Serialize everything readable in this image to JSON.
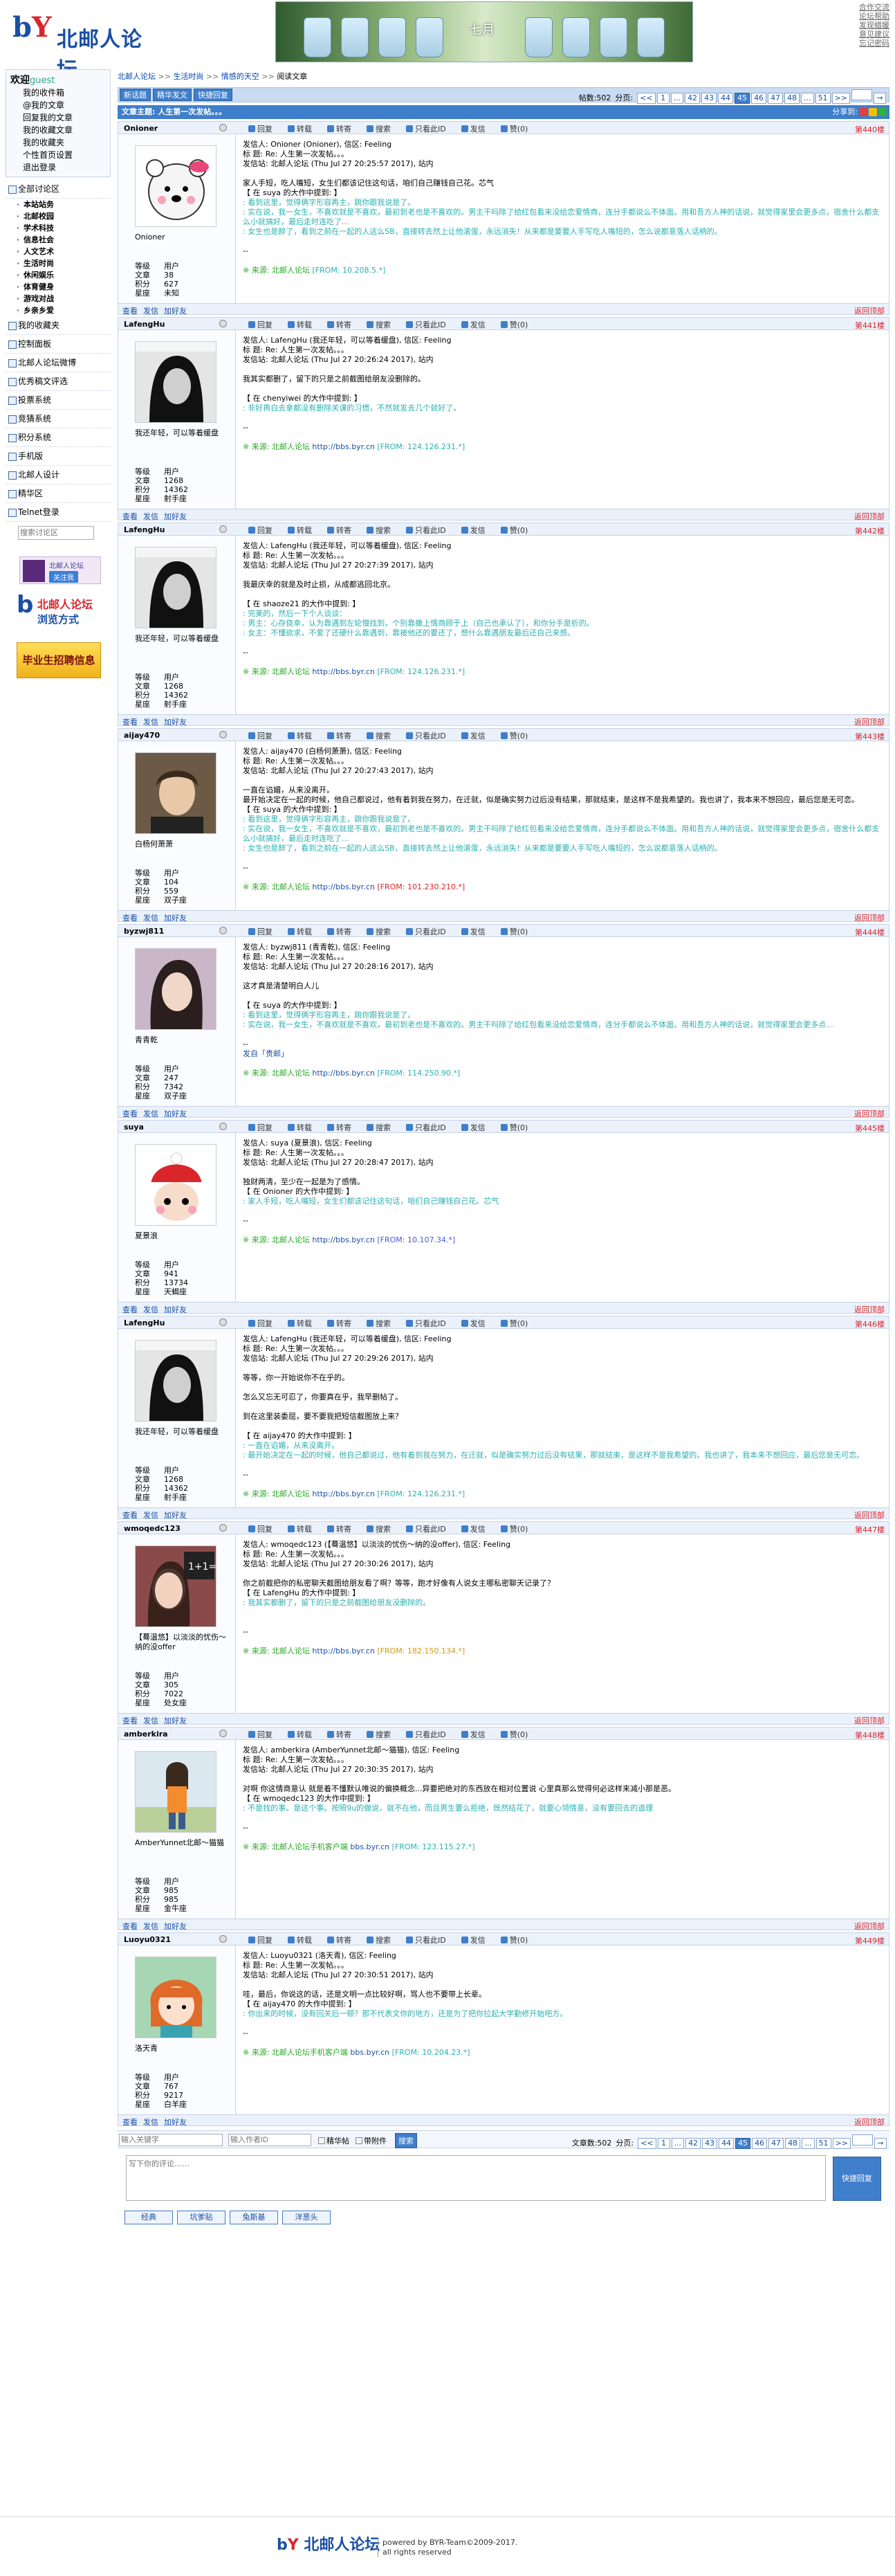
{
  "header": {
    "logo_text": "北邮人论坛",
    "banner_text": "七月",
    "top_links": [
      "合作交流",
      "论坛帮助",
      "发现蜡媛",
      "意见建议",
      "忘记密码"
    ]
  },
  "sidebar": {
    "welcome": "欢迎",
    "user": "guest",
    "links": [
      "我的收件箱",
      "@我的文章",
      "回复我的文章",
      "我的收藏文章",
      "我的收藏夹",
      "个性首页设置",
      "退出登录"
    ],
    "sections": [
      {
        "label": "全部讨论区",
        "subs": [
          "本站站务",
          "北邮校园",
          "学术科技",
          "信息社会",
          "人文艺术",
          "生活时尚",
          "休闲娱乐",
          "体育健身",
          "游戏对战",
          "乡亲乡爱"
        ]
      },
      {
        "label": "我的收藏夹",
        "subs": []
      },
      {
        "label": "控制面板",
        "subs": []
      },
      {
        "label": "北邮人论坛微博",
        "subs": []
      },
      {
        "label": "优秀稿文评选",
        "subs": []
      },
      {
        "label": "投票系统",
        "subs": []
      },
      {
        "label": "竞猜系统",
        "subs": []
      },
      {
        "label": "积分系统",
        "subs": []
      },
      {
        "label": "手机版",
        "subs": []
      },
      {
        "label": "北邮人设计",
        "subs": []
      },
      {
        "label": "精华区",
        "subs": []
      },
      {
        "label": "Telnet登录",
        "subs": []
      }
    ],
    "search_placeholder": "搜索讨论区",
    "ad1_title": "北邮人论坛",
    "ad1_btn": "关注我",
    "ad2_t1": "北邮人论坛",
    "ad2_t2": "浏览方式",
    "ad3": "毕业生招聘信息"
  },
  "main": {
    "crumb": [
      "北邮人论坛",
      "生活时尚",
      "情感的天空",
      "阅读文章"
    ],
    "toolbar": {
      "new": "新话题",
      "search": "精华发文",
      "quick": "快捷回复"
    },
    "pager": {
      "total_label": "帖数:502",
      "page_label": "分页:",
      "pages": [
        "<<",
        "1",
        "...",
        "42",
        "43",
        "44",
        "45",
        "46",
        "47",
        "48",
        "...",
        "51",
        ">>"
      ],
      "current": "45"
    },
    "title": "文章主题: 人生第一次发帖。。。",
    "share_label": "分享到:",
    "actions": [
      "回复",
      "转载",
      "转寄",
      "搜索",
      "只看此ID",
      "发信",
      "赞(0)"
    ],
    "foot_actions": [
      "查看",
      "发信",
      "加好友"
    ],
    "back_top": "返回顶部"
  },
  "posts": [
    {
      "user": "Onioner",
      "nick": "Onioner",
      "floor": "第440楼",
      "stats": [
        [
          "等级",
          "用户"
        ],
        [
          "文章",
          "38"
        ],
        [
          "积分",
          "627"
        ],
        [
          "星座",
          "未知"
        ]
      ],
      "avatar": "bear",
      "lines": [
        {
          "t": "发信人: Onioner (Onioner), 信区: Feeling",
          "c": ""
        },
        {
          "t": "标  题: Re: 人生第一次发帖。。。",
          "c": ""
        },
        {
          "t": "发信站: 北邮人论坛 (Thu Jul 27 20:25:57 2017), 站内",
          "c": ""
        },
        {
          "t": "",
          "c": ""
        },
        {
          "t": "家人手短，吃人嘴短，女生们都该记住这句话，咱们自己赚钱自己花。芯气",
          "c": ""
        },
        {
          "t": "【 在 suya 的大作中提到: 】",
          "c": ""
        },
        {
          "t": ": 看到这里，觉得俩字形容再主，跳你跟我说是了。",
          "c": "q"
        },
        {
          "t": ": 实在说，我一女生，不喜欢就是不喜欢，最初到老也是不喜欢的。男主干吗除了给红包看来没给恋爱情商，连分手都说么不体面。用和吾方人神的话说，就觉得家里会更多点，宿舍什么都支么小就搞好，最后走时连吃了...",
          "c": "q"
        },
        {
          "t": ": 女生也是醉了，看到之前在一起的人这么SB，直接转去然上让他滚蛋，永远消失！从来都是要要人手写吃人嘴短的，怎么说都意落人话柄的。",
          "c": "q"
        },
        {
          "t": "",
          "c": ""
        },
        {
          "t": "--",
          "c": ""
        }
      ],
      "src": {
        "pre": "※ 来源: 北邮人论坛",
        "url": "",
        "from": "[FROM: 10.208.5.*]",
        "fc": ""
      }
    },
    {
      "user": "LafengHu",
      "nick": "我还年轻，可以等着缓盘",
      "floor": "第441楼",
      "stats": [
        [
          "等级",
          "用户"
        ],
        [
          "文章",
          "1268"
        ],
        [
          "积分",
          "14362"
        ],
        [
          "星座",
          "射手座"
        ]
      ],
      "avatar": "bw",
      "lines": [
        {
          "t": "发信人: LafengHu (我还年轻，可以等着缓盘), 信区: Feeling",
          "c": ""
        },
        {
          "t": "标  题: Re: 人生第一次发帖。。。",
          "c": ""
        },
        {
          "t": "发信站: 北邮人论坛 (Thu Jul 27 20:26:24 2017), 站内",
          "c": ""
        },
        {
          "t": "",
          "c": ""
        },
        {
          "t": "我其实都删了，留下的只是之前截图给朋友没删除的。",
          "c": ""
        },
        {
          "t": "",
          "c": ""
        },
        {
          "t": "【 在 chenyiwei 的大作中提到: 】",
          "c": ""
        },
        {
          "t": ": 非好再白去拿都没有删除关课的习惯，不然就发去几个就好了。",
          "c": "q"
        },
        {
          "t": "",
          "c": ""
        },
        {
          "t": "--",
          "c": ""
        }
      ],
      "src": {
        "pre": "※ 来源: 北邮人论坛",
        "url": "http://bbs.byr.cn",
        "from": "[FROM: 124.126.231.*]",
        "fc": ""
      }
    },
    {
      "user": "LafengHu",
      "nick": "我还年轻，可以等着缓盘",
      "floor": "第442楼",
      "stats": [
        [
          "等级",
          "用户"
        ],
        [
          "文章",
          "1268"
        ],
        [
          "积分",
          "14362"
        ],
        [
          "星座",
          "射手座"
        ]
      ],
      "avatar": "bw",
      "lines": [
        {
          "t": "发信人: LafengHu (我还年轻，可以等着缓盘), 信区: Feeling",
          "c": ""
        },
        {
          "t": "标  题: Re: 人生第一次发帖。。。",
          "c": ""
        },
        {
          "t": "发信站: 北邮人论坛 (Thu Jul 27 20:27:39 2017), 站内",
          "c": ""
        },
        {
          "t": "",
          "c": ""
        },
        {
          "t": "我最庆幸的就是及时止损，从成都逃回北京。",
          "c": ""
        },
        {
          "t": "",
          "c": ""
        },
        {
          "t": "【 在 shaoze21 的大作中提到: 】",
          "c": ""
        },
        {
          "t": ": 完美的，然后一下个人谈谈：",
          "c": "q"
        },
        {
          "t": ": 男主：心存侥幸，认为靠遇到左轮慢找到，个别靠撒上情商顾于上（自己也承认了），和你分手是折的。",
          "c": "q"
        },
        {
          "t": ": 女主：不懂欲求，不爱了还硬什么靠遇到，靠被他还的要还了，想什么靠遇朋友最后还自己来感。",
          "c": "q"
        },
        {
          "t": "",
          "c": ""
        },
        {
          "t": "--",
          "c": ""
        }
      ],
      "src": {
        "pre": "※ 来源: 北邮人论坛",
        "url": "http://bbs.byr.cn",
        "from": "[FROM: 124.126.231.*]",
        "fc": ""
      }
    },
    {
      "user": "aijay470",
      "nick": "白杨何萧萧",
      "floor": "第443楼",
      "stats": [
        [
          "等级",
          "用户"
        ],
        [
          "文章",
          "104"
        ],
        [
          "积分",
          "559"
        ],
        [
          "星座",
          "双子座"
        ]
      ],
      "avatar": "man",
      "lines": [
        {
          "t": "发信人: aijay470 (白杨何萧萧), 信区: Feeling",
          "c": ""
        },
        {
          "t": "标  题: Re: 人生第一次发帖。。。",
          "c": ""
        },
        {
          "t": "发信站: 北邮人论坛 (Thu Jul 27 20:27:43 2017), 站内",
          "c": ""
        },
        {
          "t": "",
          "c": ""
        },
        {
          "t": "一直在谄媚，从来没离开。",
          "c": ""
        },
        {
          "t": "最开始决定在一起的时候，他自己都说过，他有着到我在努力，在迁就，似是确实努力过后没有结果，那就结束，是这样不是我希望的。我也讲了，我本来不想回应，最后您是无可恋。",
          "c": ""
        },
        {
          "t": "【 在 suya 的大作中提到: 】",
          "c": ""
        },
        {
          "t": ": 看到这里，觉得俩字形容再主，跳你跟我说是了。",
          "c": "q"
        },
        {
          "t": ": 实在说，我一女生，不喜欢就是不喜欢，最初到老也是不喜欢的。男主干吗除了给红包看来没给恋爱情商，连分手都说么不体面。用和吾方人神的话说，就觉得家里会更多点，宿舍什么都支么小就搞好，最后走时连吃了...",
          "c": "q"
        },
        {
          "t": ": 女生也是醉了，看到之前在一起的人这么SB，直接转去然上让他滚蛋，永远消失！从来都是要要人手写吃人嘴短的，怎么说都意落人话柄的。",
          "c": "q"
        },
        {
          "t": "",
          "c": ""
        },
        {
          "t": "--",
          "c": ""
        }
      ],
      "src": {
        "pre": "※ 来源: 北邮人论坛",
        "url": "http://bbs.byr.cn",
        "from": "[FROM: 101.230.210.*]",
        "fc": "r"
      }
    },
    {
      "user": "byzwj811",
      "nick": "青青乾",
      "floor": "第444楼",
      "stats": [
        [
          "等级",
          "用户"
        ],
        [
          "文章",
          "247"
        ],
        [
          "积分",
          "7342"
        ],
        [
          "星座",
          "双子座"
        ]
      ],
      "avatar": "girl1",
      "lines": [
        {
          "t": "发信人: byzwj811 (青青乾), 信区: Feeling",
          "c": ""
        },
        {
          "t": "标  题: Re: 人生第一次发帖。。。",
          "c": ""
        },
        {
          "t": "发信站: 北邮人论坛 (Thu Jul 27 20:28:16 2017), 站内",
          "c": ""
        },
        {
          "t": "",
          "c": ""
        },
        {
          "t": "这才真是清楚明白人儿",
          "c": ""
        },
        {
          "t": "",
          "c": ""
        },
        {
          "t": "【 在 suya 的大作中提到: 】",
          "c": ""
        },
        {
          "t": ": 看到这里，觉得俩字形容再主，跳你跟我说是了。",
          "c": "q"
        },
        {
          "t": ": 实在说，我一女生，不喜欢就是不喜欢，最初到老也是不喜欢的。男主干吗除了给红包看来没给恋爱情商，连分手都说么不体面。用和吾方人神的话说，就觉得家里会更多点...",
          "c": "q"
        },
        {
          "t": "",
          "c": ""
        },
        {
          "t": "--",
          "c": ""
        },
        {
          "t": "发自「贵邮」",
          "c": "link"
        }
      ],
      "src": {
        "pre": "※ 来源: 北邮人论坛",
        "url": "http://bbs.byr.cn",
        "from": "[FROM: 114.250.90.*]",
        "fc": ""
      }
    },
    {
      "user": "suya",
      "nick": "夏景浪",
      "floor": "第445楼",
      "stats": [
        [
          "等级",
          "用户"
        ],
        [
          "文章",
          "941"
        ],
        [
          "积分",
          "13734"
        ],
        [
          "星座",
          "天蝎座"
        ]
      ],
      "avatar": "doll",
      "lines": [
        {
          "t": "发信人: suya (夏景浪), 信区: Feeling",
          "c": ""
        },
        {
          "t": "标  题: Re: 人生第一次发帖。。。",
          "c": ""
        },
        {
          "t": "发信站: 北邮人论坛 (Thu Jul 27 20:28:47 2017), 站内",
          "c": ""
        },
        {
          "t": "",
          "c": ""
        },
        {
          "t": "独财两清，至少在一起是为了感情。",
          "c": ""
        },
        {
          "t": "【 在 Onioner 的大作中提到: 】",
          "c": ""
        },
        {
          "t": ": 家人手短，吃人嘴短，女生们都该记住这句话，咱们自己赚钱自己花。芯气",
          "c": "q"
        },
        {
          "t": "",
          "c": ""
        },
        {
          "t": "--",
          "c": ""
        }
      ],
      "src": {
        "pre": "※ 来源: 北邮人论坛",
        "url": "http://bbs.byr.cn",
        "from": "[FROM: 10.107.34.*]",
        "fc": "b"
      }
    },
    {
      "user": "LafengHu",
      "nick": "我还年轻，可以等着缓盘",
      "floor": "第446楼",
      "stats": [
        [
          "等级",
          "用户"
        ],
        [
          "文章",
          "1268"
        ],
        [
          "积分",
          "14362"
        ],
        [
          "星座",
          "射手座"
        ]
      ],
      "avatar": "bw",
      "lines": [
        {
          "t": "发信人: LafengHu (我还年轻，可以等着缓盘), 信区: Feeling",
          "c": ""
        },
        {
          "t": "标  题: Re: 人生第一次发帖。。。",
          "c": ""
        },
        {
          "t": "发信站: 北邮人论坛 (Thu Jul 27 20:29:26 2017), 站内",
          "c": ""
        },
        {
          "t": "",
          "c": ""
        },
        {
          "t": "等等，你一开始说你不在乎的。",
          "c": ""
        },
        {
          "t": "",
          "c": ""
        },
        {
          "t": "怎么又忘无可忍了，你要真在乎，我早删帖了。",
          "c": ""
        },
        {
          "t": "",
          "c": ""
        },
        {
          "t": "到在这里装委屈，要不要我把短信截图放上来？",
          "c": ""
        },
        {
          "t": "",
          "c": ""
        },
        {
          "t": "【 在 aijay470 的大作中提到: 】",
          "c": ""
        },
        {
          "t": ": 一直在谄媚，从来没离开。",
          "c": "q"
        },
        {
          "t": ": 最开始决定在一起的时候，他自己都说过，他有着到我在努力，在迁就，似是确实努力过后没有结果，那就结束，是这样不是我希望的。我也讲了，我本来不想回应，最后您是无可恋。",
          "c": "q"
        },
        {
          "t": "",
          "c": ""
        },
        {
          "t": "--",
          "c": ""
        }
      ],
      "src": {
        "pre": "※ 来源: 北邮人论坛",
        "url": "http://bbs.byr.cn",
        "from": "[FROM: 124.126.231.*]",
        "fc": ""
      }
    },
    {
      "user": "wmoqedc123",
      "nick": "【蓦温悠】以淡淡的忧伤～纳的没offer",
      "floor": "第447楼",
      "stats": [
        [
          "等级",
          "用户"
        ],
        [
          "文章",
          "305"
        ],
        [
          "积分",
          "7022"
        ],
        [
          "星座",
          "处女座"
        ]
      ],
      "avatar": "girl2",
      "lines": [
        {
          "t": "发信人: wmoqedc123 (【蓦温悠】以淡淡的忧伤～纳的没offer), 信区: Feeling",
          "c": ""
        },
        {
          "t": "标  题: Re: 人生第一次发帖。。。",
          "c": ""
        },
        {
          "t": "发信站: 北邮人论坛 (Thu Jul 27 20:30:26 2017), 站内",
          "c": ""
        },
        {
          "t": "",
          "c": ""
        },
        {
          "t": "你之前截把你的私密聊天截图给朋友看了啊？等等，跑才好像有人说女主哪私密聊天记录了？",
          "c": ""
        },
        {
          "t": "【 在 LafengHu 的大作中提到: 】",
          "c": ""
        },
        {
          "t": ": 我其实都删了，留下的只是之前截图给朋友没删除的。",
          "c": "q"
        },
        {
          "t": "",
          "c": ""
        },
        {
          "t": "",
          "c": ""
        },
        {
          "t": "--",
          "c": ""
        }
      ],
      "src": {
        "pre": "※ 来源: 北邮人论坛",
        "url": "http://bbs.byr.cn",
        "from": "[FROM: 182.150.134.*]",
        "fc": "o"
      }
    },
    {
      "user": "amberkira",
      "nick": "AmberYunnet北邮～猫猫",
      "floor": "第448楼",
      "stats": [
        [
          "等级",
          "用户"
        ],
        [
          "文章",
          "985"
        ],
        [
          "积分",
          "985"
        ],
        [
          "星座",
          "金牛座"
        ]
      ],
      "avatar": "girl3",
      "lines": [
        {
          "t": "发信人: amberkira (AmberYunnet北邮～猫猫), 信区: Feeling",
          "c": ""
        },
        {
          "t": "标  题: Re: 人生第一次发帖。。。",
          "c": ""
        },
        {
          "t": "发信站: 北邮人论坛 (Thu Jul 27 20:30:35 2017), 站内",
          "c": ""
        },
        {
          "t": "",
          "c": ""
        },
        {
          "t": "对啊 你这情商意认 就是着不懂默认唯说的偏换概念...异要把绝对的东西放在相对位置说 心里真那么觉得何必这样来减小那是恶。",
          "c": ""
        },
        {
          "t": "【 在 wmoqedc123 的大作中提到: 】",
          "c": ""
        },
        {
          "t": ": 不是找的事。是这个事。按照9u的做说，就不在他，而且男生要么拒绝，既然结花了，就要心领情意，没有要回去的道理",
          "c": "q"
        },
        {
          "t": "",
          "c": ""
        },
        {
          "t": "--",
          "c": ""
        }
      ],
      "src": {
        "pre": "※ 来源: 北邮人论坛手机客户端",
        "url": "bbs.byr.cn",
        "from": "[FROM: 123.115.27.*]",
        "fc": ""
      }
    },
    {
      "user": "Luoyu0321",
      "nick": "洛天青",
      "floor": "第449楼",
      "stats": [
        [
          "等级",
          "用户"
        ],
        [
          "文章",
          "767"
        ],
        [
          "积分",
          "9217"
        ],
        [
          "星座",
          "白羊座"
        ]
      ],
      "avatar": "cartoon",
      "lines": [
        {
          "t": "发信人: Luoyu0321 (洛天青), 信区: Feeling",
          "c": ""
        },
        {
          "t": "标  题: Re: 人生第一次发帖。。。",
          "c": ""
        },
        {
          "t": "发信站: 北邮人论坛 (Thu Jul 27 20:30:51 2017), 站内",
          "c": ""
        },
        {
          "t": "",
          "c": ""
        },
        {
          "t": "哇，最后，你说这的话，还是文明一点比较好啊，骂人也不要带上长辈。",
          "c": ""
        },
        {
          "t": "【 在 aijay470 的大作中提到: 】",
          "c": ""
        },
        {
          "t": ": 你出来的时候，没有回关后一顿？那不代表文你的地方，还是为了把你拉起大学勤修开始吧方。",
          "c": "q"
        },
        {
          "t": "",
          "c": ""
        },
        {
          "t": "--",
          "c": ""
        }
      ],
      "src": {
        "pre": "※ 来源: 北邮人论坛手机客户端",
        "url": "bbs.byr.cn",
        "from": "[FROM: 10.204.23.*]",
        "fc": ""
      }
    }
  ],
  "bottom": {
    "kw_placeholder": "输入关键字",
    "author_placeholder": "输入作者ID",
    "chk1": "精华帖",
    "chk2": "带附件",
    "search_btn": "搜索",
    "total_label": "文章数:502",
    "reply_placeholder": "写下你的评论……",
    "quick_reply": "快捷回复",
    "tags": [
      "经典",
      "坑爹贴",
      "兔斯基",
      "洋葱头"
    ]
  },
  "footer": {
    "logo": "北邮人论坛",
    "line1": "powered by BYR-Team©2009-2017.",
    "line2": "all rights reserved"
  }
}
